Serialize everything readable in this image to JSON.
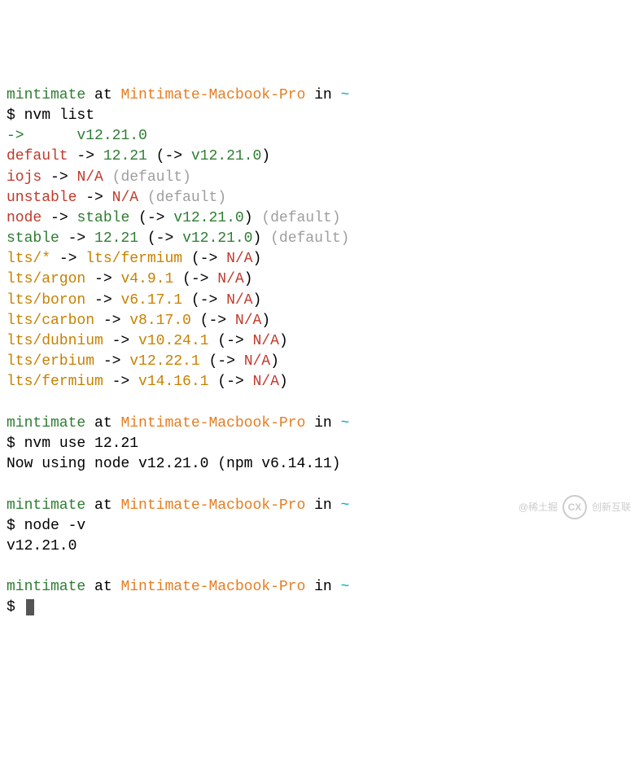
{
  "prompt1": {
    "user": "mintimate",
    "at": " at ",
    "host": "Mintimate-Macbook-Pro",
    "in": " in ",
    "path": "~",
    "prompt_char": "$ ",
    "command": "nvm list"
  },
  "nvm_list": {
    "current_arrow": "->",
    "current_spaces": "      ",
    "current_version": "v12.21.0",
    "line_default": {
      "key": "default",
      "arrow": " -> ",
      "val": "12.21",
      "open": " (-> ",
      "resolved": "v12.21.0",
      "close": ")"
    },
    "line_iojs": {
      "key": "iojs",
      "arrow": " -> ",
      "val": "N/A",
      "suffix": " (default)"
    },
    "line_unstable": {
      "key": "unstable",
      "arrow": " -> ",
      "val": "N/A",
      "suffix": " (default)"
    },
    "line_node": {
      "key": "node",
      "arrow": " -> ",
      "val": "stable",
      "open": " (-> ",
      "resolved": "v12.21.0",
      "close": ")",
      "suffix": " (default)"
    },
    "line_stable": {
      "key": "stable",
      "arrow": " -> ",
      "val": "12.21",
      "open": " (-> ",
      "resolved": "v12.21.0",
      "close": ")",
      "suffix": " (default)"
    },
    "line_ltsstar": {
      "key": "lts/*",
      "arrow": " -> ",
      "val": "lts/fermium",
      "open": " (-> ",
      "resolved": "N/A",
      "close": ")"
    },
    "line_argon": {
      "key": "lts/argon",
      "arrow": " -> ",
      "val": "v4.9.1",
      "open": " (-> ",
      "resolved": "N/A",
      "close": ")"
    },
    "line_boron": {
      "key": "lts/boron",
      "arrow": " -> ",
      "val": "v6.17.1",
      "open": " (-> ",
      "resolved": "N/A",
      "close": ")"
    },
    "line_carbon": {
      "key": "lts/carbon",
      "arrow": " -> ",
      "val": "v8.17.0",
      "open": " (-> ",
      "resolved": "N/A",
      "close": ")"
    },
    "line_dubnium": {
      "key": "lts/dubnium",
      "arrow": " -> ",
      "val": "v10.24.1",
      "open": " (-> ",
      "resolved": "N/A",
      "close": ")"
    },
    "line_erbium": {
      "key": "lts/erbium",
      "arrow": " -> ",
      "val": "v12.22.1",
      "open": " (-> ",
      "resolved": "N/A",
      "close": ")"
    },
    "line_fermium": {
      "key": "lts/fermium",
      "arrow": " -> ",
      "val": "v14.16.1",
      "open": " (-> ",
      "resolved": "N/A",
      "close": ")"
    }
  },
  "prompt2": {
    "user": "mintimate",
    "at": " at ",
    "host": "Mintimate-Macbook-Pro",
    "in": " in ",
    "path": "~",
    "prompt_char": "$ ",
    "command": "nvm use 12.21",
    "output": "Now using node v12.21.0 (npm v6.14.11)"
  },
  "prompt3": {
    "user": "mintimate",
    "at": " at ",
    "host": "Mintimate-Macbook-Pro",
    "in": " in ",
    "path": "~",
    "prompt_char": "$ ",
    "command": "node -v",
    "output": "v12.21.0"
  },
  "prompt4": {
    "user": "mintimate",
    "at": " at ",
    "host": "Mintimate-Macbook-Pro",
    "in": " in ",
    "path": "~",
    "prompt_char": "$ "
  },
  "watermark": {
    "text1": "@稀土掘",
    "text2": "创新互联",
    "logo": "CX"
  }
}
